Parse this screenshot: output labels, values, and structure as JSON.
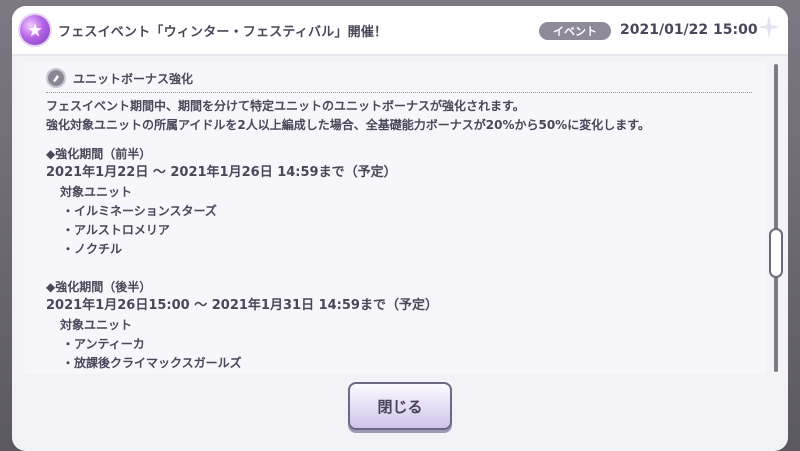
{
  "header": {
    "icon": "event-star-icon",
    "title": "フェスイベント「ウィンター・フェスティバル」開催！",
    "badge": "イベント",
    "date": "2021/01/22 15:00"
  },
  "section": {
    "icon": "unit-icon",
    "title": "ユニットボーナス強化"
  },
  "lines": [
    "フェスイベント期間中、期間を分けて特定ユニットのユニットボーナスが強化されます。",
    "強化対象ユニットの所属アイドルを2人以上編成した場合、全基礎能力ボーナスが20%から50%に変化します。",
    "◆強化期間（前半）",
    "2021年1月22日 〜 2021年1月26日 14:59まで（予定）",
    "対象ユニット",
    "・イルミネーションスターズ",
    "・アルストロメリア",
    "・ノクチル",
    "◆強化期間（後半）",
    "2021年1月26日15:00 〜 2021年1月31日 14:59まで（予定）",
    "対象ユニット",
    "・アンティーカ",
    "・放課後クライマックスガールズ"
  ],
  "close_button": "閉じる",
  "colors": {
    "text": "#4b4659",
    "badge": "#8e8a98",
    "panel": "#f7f6fa",
    "button_border": "#6c6782"
  }
}
